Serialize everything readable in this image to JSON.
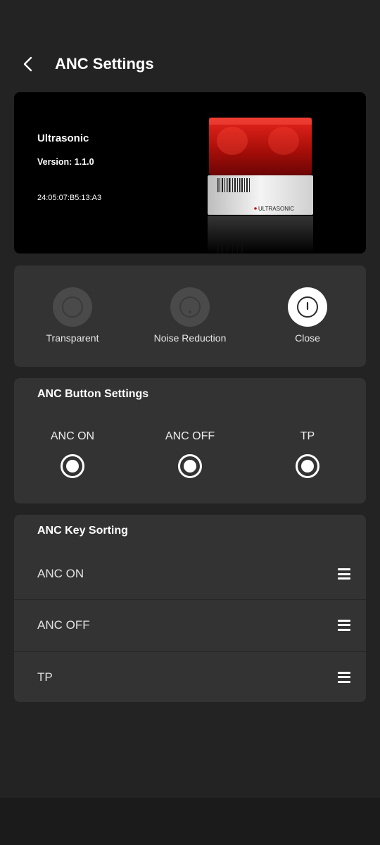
{
  "header": {
    "title": "ANC Settings"
  },
  "device": {
    "name": "Ultrasonic",
    "version": "Version: 1.1.0",
    "mac": "24:05:07:B5:13:A3",
    "product_brand_text": "ULTRASONIC"
  },
  "modes": {
    "selected": "Close",
    "items": [
      {
        "label": "Transparent",
        "icon": "transparent-mode-icon",
        "active": false
      },
      {
        "label": "Noise Reduction",
        "icon": "noise-reduction-icon",
        "active": false
      },
      {
        "label": "Close",
        "icon": "power-icon",
        "active": true
      }
    ]
  },
  "anc_button_settings": {
    "title": "ANC Button Settings",
    "options": [
      {
        "label": "ANC ON",
        "checked": true
      },
      {
        "label": "ANC OFF",
        "checked": true
      },
      {
        "label": "TP",
        "checked": true
      }
    ]
  },
  "anc_key_sorting": {
    "title": "ANC Key Sorting",
    "items": [
      {
        "label": "ANC ON",
        "icon": "drag-handle-icon"
      },
      {
        "label": "ANC OFF",
        "icon": "drag-handle-icon"
      },
      {
        "label": "TP",
        "icon": "drag-handle-icon"
      }
    ]
  },
  "colors": {
    "background": "#232323",
    "card": "#333333",
    "accent": "#ffffff",
    "product_red": "#c8140f"
  }
}
